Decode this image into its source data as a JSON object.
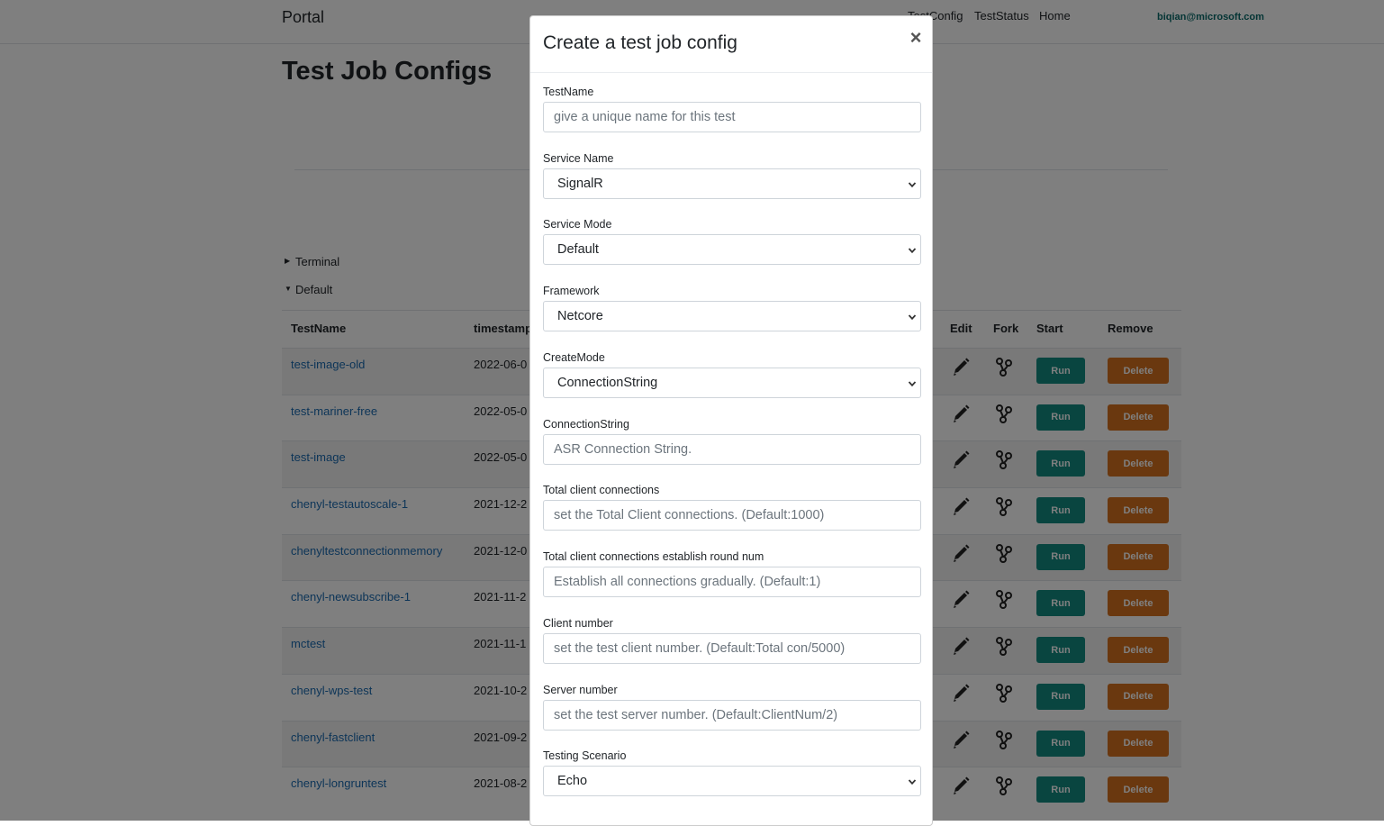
{
  "navbar": {
    "brand": "Portal",
    "links": [
      "TestConfig",
      "TestStatus",
      "Home"
    ],
    "user": "biqian@microsoft.com"
  },
  "page": {
    "title": "Test Job Configs",
    "tree": [
      {
        "label": "Terminal",
        "expanded": false
      },
      {
        "label": "Default",
        "expanded": true
      }
    ]
  },
  "table": {
    "headers": {
      "name": "TestName",
      "timestamp": "timestamp",
      "edit": "Edit",
      "fork": "Fork",
      "start": "Start",
      "remove": "Remove"
    },
    "run_label": "Run",
    "delete_label": "Delete",
    "rows": [
      {
        "name": "test-image-old",
        "timestamp": "2022-06-0"
      },
      {
        "name": "test-mariner-free",
        "timestamp": "2022-05-0"
      },
      {
        "name": "test-image",
        "timestamp": "2022-05-0"
      },
      {
        "name": "chenyl-testautoscale-1",
        "timestamp": "2021-12-2"
      },
      {
        "name": "chenyltestconnectionmemory",
        "timestamp": "2021-12-0"
      },
      {
        "name": "chenyl-newsubscribe-1",
        "timestamp": "2021-11-2"
      },
      {
        "name": "mctest",
        "timestamp": "2021-11-1"
      },
      {
        "name": "chenyl-wps-test",
        "timestamp": "2021-10-2"
      },
      {
        "name": "chenyl-fastclient",
        "timestamp": "2021-09-2"
      },
      {
        "name": "chenyl-longruntest",
        "timestamp": "2021-08-2"
      }
    ]
  },
  "colors": {
    "run": "#128a80",
    "delete": "#d4701e",
    "link": "#1a6ab0",
    "user": "#0a6b6b"
  },
  "modal": {
    "title": "Create a test job config",
    "close_label": "×",
    "fields": {
      "test_name": {
        "label": "TestName",
        "placeholder": "give a unique name for this test"
      },
      "service_name": {
        "label": "Service Name",
        "value": "SignalR"
      },
      "service_mode": {
        "label": "Service Mode",
        "value": "Default"
      },
      "framework": {
        "label": "Framework",
        "value": "Netcore"
      },
      "create_mode": {
        "label": "CreateMode",
        "value": "ConnectionString"
      },
      "connection_string": {
        "label": "ConnectionString",
        "placeholder": "ASR Connection String."
      },
      "total_connections": {
        "label": "Total client connections",
        "placeholder": "set the Total Client connections. (Default:1000)"
      },
      "round_num": {
        "label": "Total client connections establish round num",
        "placeholder": "Establish all connections gradually. (Default:1)"
      },
      "client_number": {
        "label": "Client number",
        "placeholder": "set the test client number. (Default:Total con/5000)"
      },
      "server_number": {
        "label": "Server number",
        "placeholder": "set the test server number. (Default:ClientNum/2)"
      },
      "scenario": {
        "label": "Testing Scenario",
        "value": "Echo"
      }
    }
  }
}
